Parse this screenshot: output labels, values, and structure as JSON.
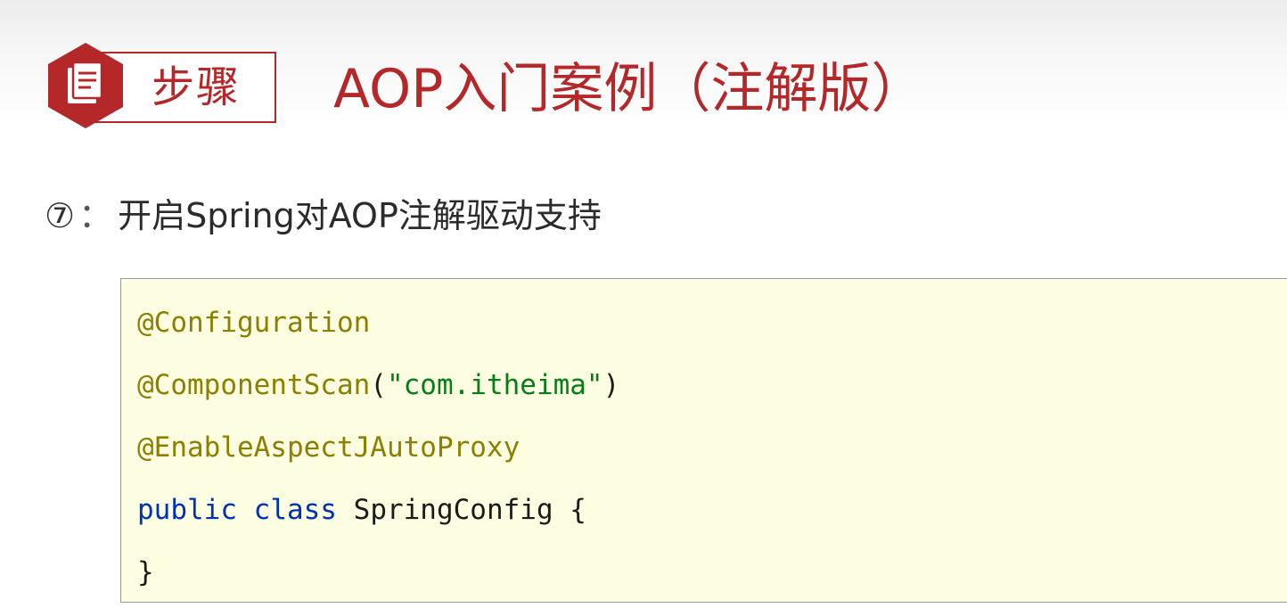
{
  "header": {
    "badge_label": "步骤",
    "badge_icon": "document-icon",
    "title": "AOP入门案例（注解版）"
  },
  "step": {
    "number": "⑦",
    "separator": "：",
    "text": "开启Spring对AOP注解驱动支持"
  },
  "code": {
    "line1": {
      "annotation": "@Configuration"
    },
    "line2": {
      "annotation": "@ComponentScan",
      "open": "(",
      "string": "\"com.itheima\"",
      "close": ")"
    },
    "line3": {
      "annotation": "@EnableAspectJAutoProxy"
    },
    "line4": {
      "kw_public": "public",
      "kw_class": "class",
      "class_name": "SpringConfig",
      "brace": "{"
    },
    "line5": {
      "brace": "}"
    }
  },
  "colors": {
    "brand_red": "#b5282a",
    "code_background": "#fdfde2",
    "annotation": "#8b8000",
    "string": "#067d17",
    "keyword": "#0033b3"
  }
}
